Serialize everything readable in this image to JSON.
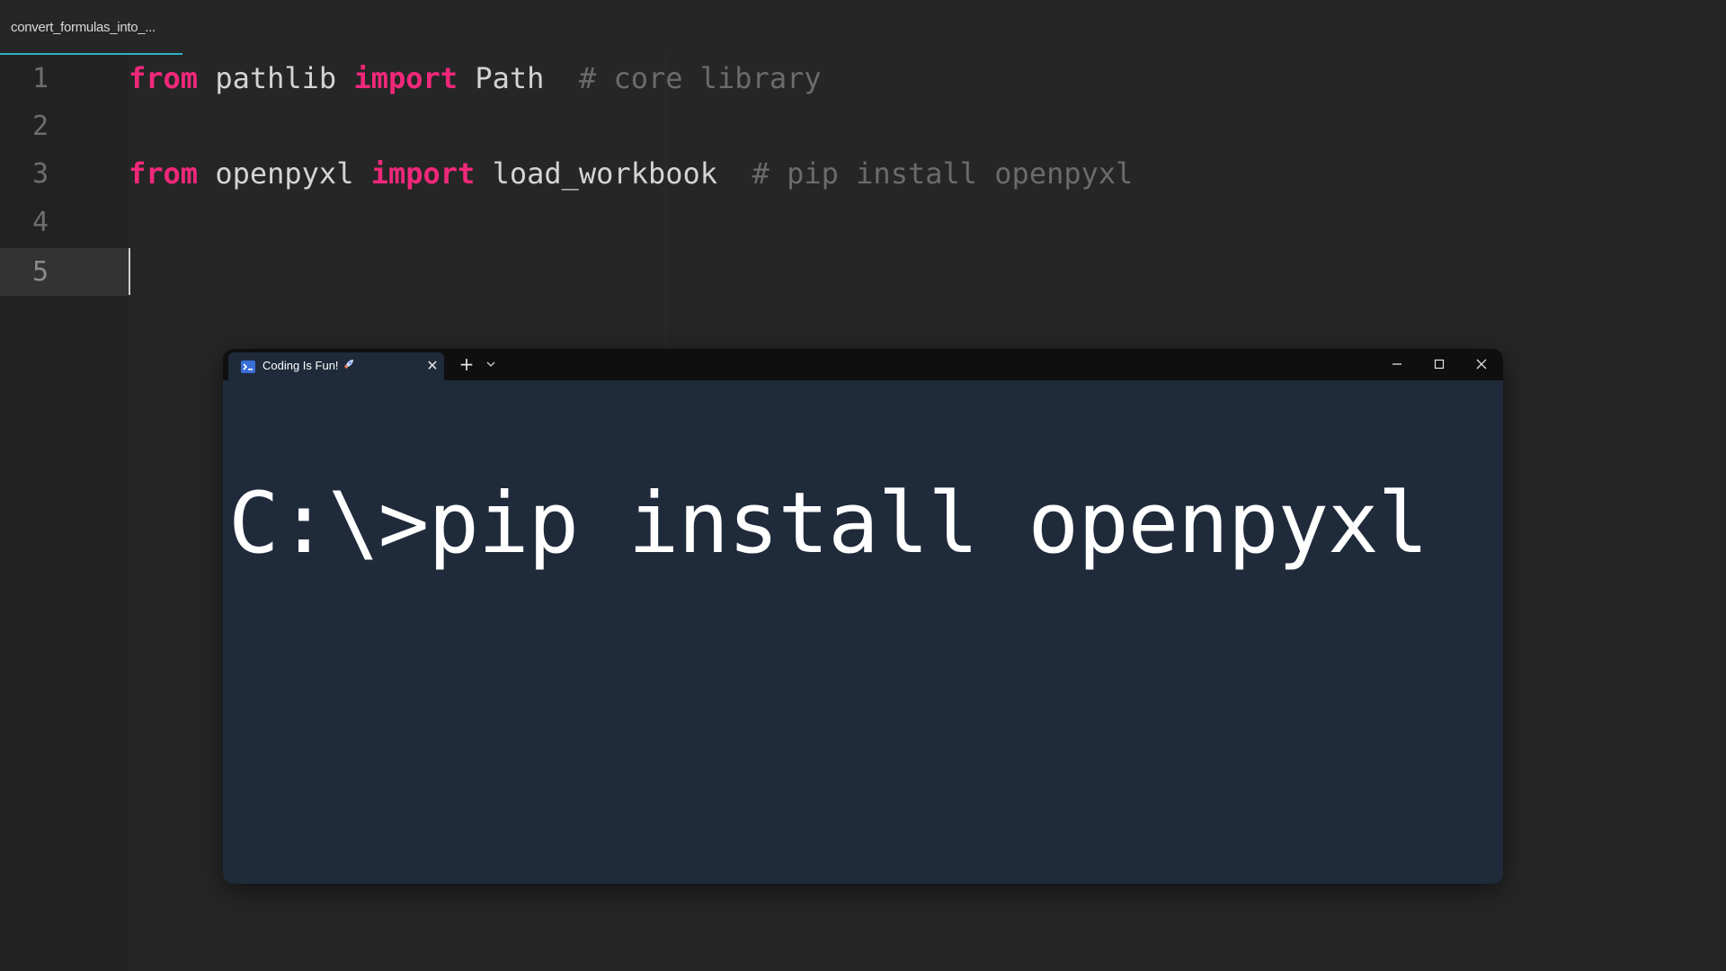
{
  "editor": {
    "tab_label": "convert_formulas_into_...",
    "line_numbers": [
      "1",
      "2",
      "3",
      "4",
      "5"
    ],
    "active_line": "5",
    "lines": [
      {
        "kw1": "from",
        "mod": "pathlib",
        "kw2": "import",
        "name": "Path",
        "comment": "# core library"
      },
      {
        "kw1": "from",
        "mod": "openpyxl",
        "kw2": "import",
        "name": "load_workbook",
        "comment": "# pip install openpyxl"
      }
    ]
  },
  "terminal": {
    "tab_title": "Coding Is Fun!",
    "tab_emoji_icon": "rocket-icon",
    "command_text": "C:\\>pip install openpyxl",
    "colors": {
      "background": "#1f2a3a",
      "titlebar": "#0f0f0f"
    }
  },
  "colors": {
    "keyword": "#f0287a",
    "comment": "#6b6b6b",
    "editor_bg": "#262626",
    "tab_underline": "#2bb3c0"
  }
}
